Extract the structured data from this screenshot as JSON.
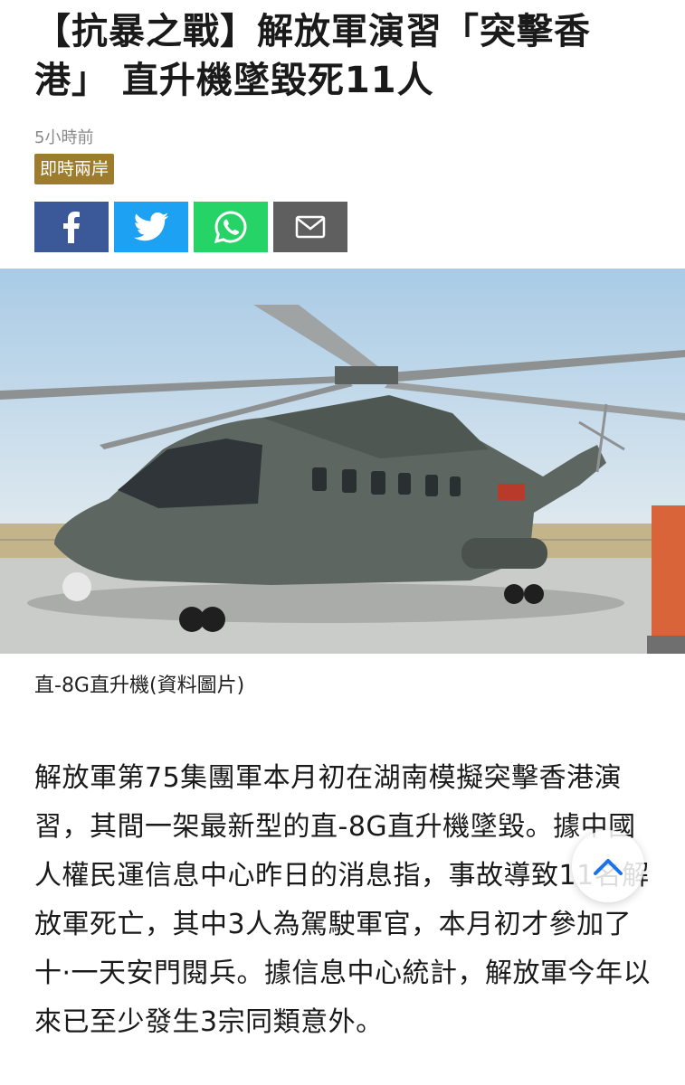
{
  "article": {
    "headline": "【抗暴之戰】解放軍演習「突擊香港」 直升機墜毀死11人",
    "timestamp": "5小時前",
    "category": "即時兩岸",
    "image_caption": "直-8G直升機(資料圖片)",
    "body": "解放軍第75集團軍本月初在湖南模擬突擊香港演習，其間一架最新型的直-8G直升機墜毀。據中國人權民運信息中心昨日的消息指，事故導致11名解放軍死亡，其中3人為駕駛軍官，本月初才參加了十·一天安門閱兵。據信息中心統計，解放軍今年以來已至少發生3宗同類意外。"
  },
  "share": {
    "buttons": [
      {
        "icon": "facebook-icon",
        "color": "#3b5998"
      },
      {
        "icon": "twitter-icon",
        "color": "#1da1f2"
      },
      {
        "icon": "whatsapp-icon",
        "color": "#25d366"
      },
      {
        "icon": "mail-icon",
        "color": "#5f5f5f"
      }
    ]
  },
  "colors": {
    "category_badge": "#9e7c2d",
    "scroll_arrow": "#1a73e8"
  },
  "controls": {
    "scroll_top_icon": "chevron-up-icon"
  }
}
